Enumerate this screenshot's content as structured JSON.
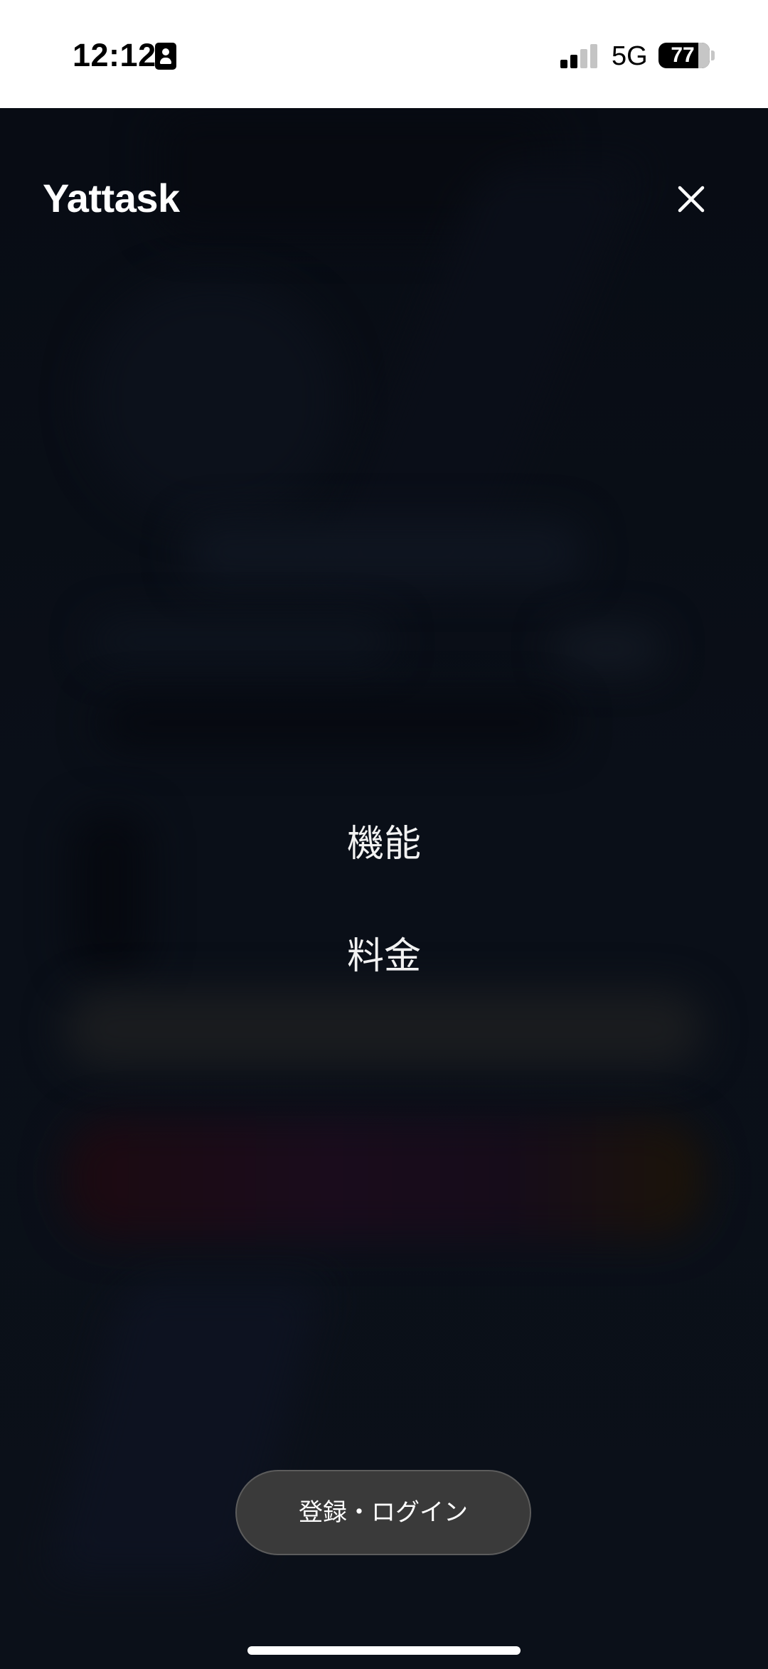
{
  "status_bar": {
    "time": "12:12",
    "network": "5G",
    "battery_level": "77",
    "signal_bars_filled": 2,
    "signal_bars_total": 4,
    "icons": [
      "id-badge-icon",
      "signal-icon",
      "battery-icon"
    ]
  },
  "header": {
    "brand": "Yattask",
    "close_icon": "close-icon"
  },
  "menu": {
    "items": [
      {
        "label": "機能"
      },
      {
        "label": "料金"
      }
    ]
  },
  "login_button": {
    "label": "登録・ログイン"
  },
  "colors": {
    "background": "#0b0f16",
    "status_bar_bg": "#ffffff",
    "text_primary": "#ffffff",
    "button_bg": "#3a3a3a",
    "button_border": "#5c5c5c"
  }
}
